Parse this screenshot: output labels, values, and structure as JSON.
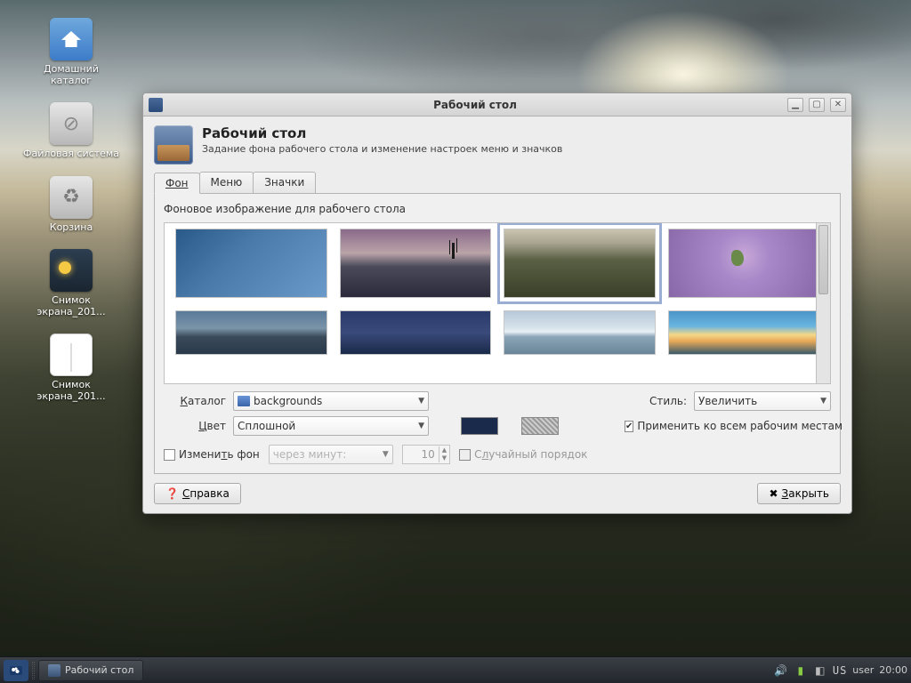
{
  "desktop": {
    "icons": [
      {
        "name": "home-folder",
        "label": "Домашний каталог"
      },
      {
        "name": "filesystem",
        "label": "Файловая система"
      },
      {
        "name": "trash",
        "label": "Корзина"
      },
      {
        "name": "screenshot-1",
        "label": "Снимок экрана_201..."
      },
      {
        "name": "screenshot-2",
        "label": "Снимок экрана_201..."
      }
    ]
  },
  "window": {
    "title": "Рабочий стол",
    "heading": "Рабочий стол",
    "subheading": "Задание фона рабочего стола и изменение настроек меню и значков",
    "tabs": {
      "background": "Фон",
      "menu": "Меню",
      "icons": "Значки"
    },
    "background_panel": {
      "image_label": "Фоновое изображение для рабочего стола",
      "wallpapers": [
        {
          "id": "wp1",
          "selected": false
        },
        {
          "id": "wp2",
          "selected": false
        },
        {
          "id": "wp3",
          "selected": true
        },
        {
          "id": "wp4",
          "selected": false
        },
        {
          "id": "wp5",
          "selected": false
        },
        {
          "id": "wp6",
          "selected": false
        },
        {
          "id": "wp7",
          "selected": false
        },
        {
          "id": "wp8",
          "selected": false
        }
      ],
      "catalog_label": "Каталог",
      "catalog_value": "backgrounds",
      "style_label": "Стиль:",
      "style_value": "Увеличить",
      "color_label": "Цвет",
      "color_mode": "Сплошной",
      "color_primary": "#1a2a4a",
      "apply_all_label": "Применить ко всем рабочим местам",
      "apply_all_checked": true,
      "change_bg_label": "Изменить фон",
      "change_bg_checked": false,
      "interval_label": "через минут:",
      "interval_value": "10",
      "random_label": "Случайный порядок",
      "random_checked": false
    },
    "buttons": {
      "help": "Справка",
      "close": "Закрыть"
    }
  },
  "taskbar": {
    "active_task": "Рабочий стол",
    "keyboard_layout": "US",
    "user": "user",
    "clock": "20:00"
  }
}
